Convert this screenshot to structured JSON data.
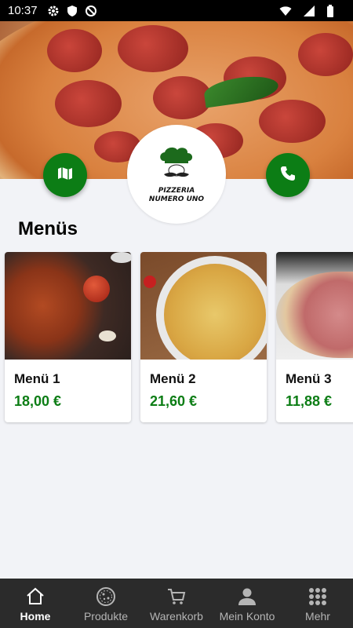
{
  "status_bar": {
    "time": "10:37",
    "icons_left": [
      "gear-icon",
      "shield-icon",
      "no-sync-icon"
    ],
    "icons_right": [
      "wifi-icon",
      "signal-icon",
      "battery-icon"
    ]
  },
  "hero": {
    "logo_text": "PIZZERIA NUMERO UNO",
    "map_button_icon": "map-icon",
    "phone_button_icon": "phone-icon"
  },
  "menus": {
    "title": "Menüs",
    "items": [
      {
        "name": "Menü 1",
        "price": "18,00 €"
      },
      {
        "name": "Menü 2",
        "price": "21,60 €"
      },
      {
        "name": "Menü 3",
        "price": "11,88 €"
      }
    ]
  },
  "bottom_nav": {
    "items": [
      {
        "label": "Home",
        "icon": "home-icon",
        "active": true
      },
      {
        "label": "Produkte",
        "icon": "pizza-icon",
        "active": false
      },
      {
        "label": "Warenkorb",
        "icon": "cart-icon",
        "active": false
      },
      {
        "label": "Mein Konto",
        "icon": "person-icon",
        "active": false
      },
      {
        "label": "Mehr",
        "icon": "grid-icon",
        "active": false
      }
    ]
  },
  "colors": {
    "accent": "#0c7d15",
    "nav_background": "#2b2b2b",
    "page_background": "#f2f3f7"
  }
}
